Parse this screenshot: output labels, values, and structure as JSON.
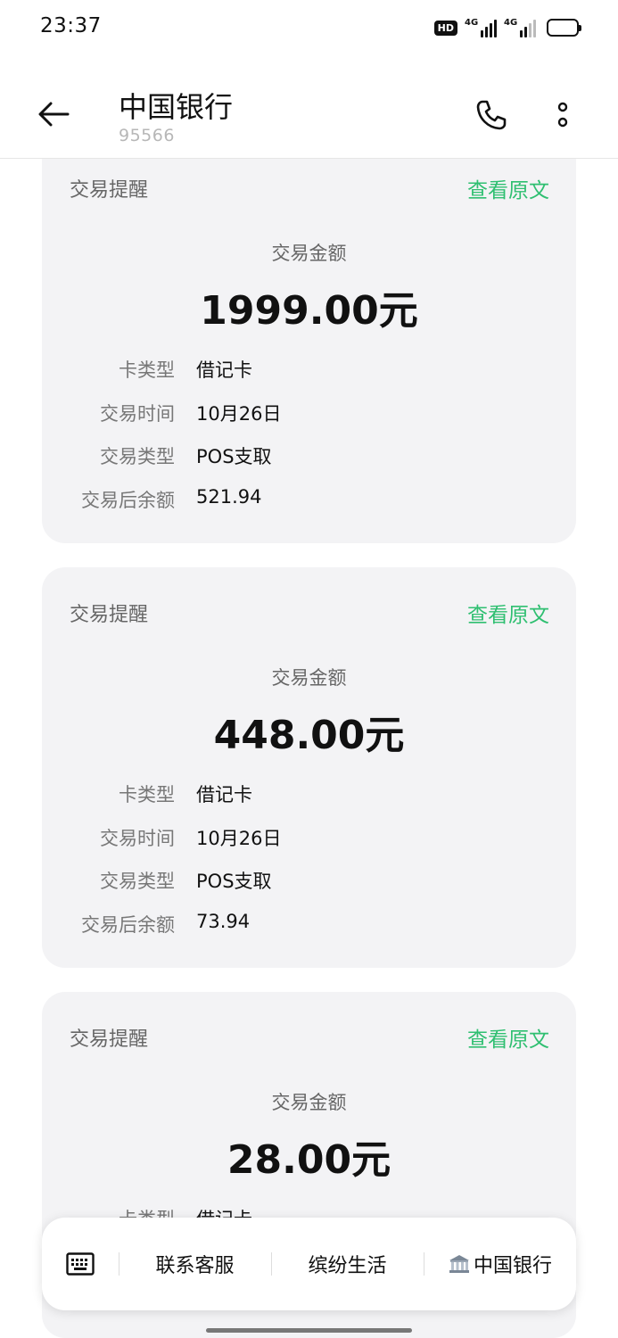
{
  "status_bar": {
    "time": "23:37",
    "hd_label": "HD",
    "network_1": "4G",
    "network_2": "4G"
  },
  "header": {
    "title": "中国银行",
    "subtitle": "95566",
    "back_icon": "arrow-left-icon",
    "call_icon": "phone-icon",
    "more_icon": "more-vertical-icon"
  },
  "messages": [
    {
      "label": "交易提醒",
      "link": "查看原文",
      "amount_caption": "交易金额",
      "amount": "1999.00元",
      "rows": [
        {
          "key": "卡类型",
          "value": "借记卡"
        },
        {
          "key": "交易时间",
          "value": "10月26日"
        },
        {
          "key": "交易类型",
          "value": "POS支取"
        },
        {
          "key": "交易后余额",
          "value": "521.94"
        }
      ]
    },
    {
      "label": "交易提醒",
      "link": "查看原文",
      "amount_caption": "交易金额",
      "amount": "448.00元",
      "rows": [
        {
          "key": "卡类型",
          "value": "借记卡"
        },
        {
          "key": "交易时间",
          "value": "10月26日"
        },
        {
          "key": "交易类型",
          "value": "POS支取"
        },
        {
          "key": "交易后余额",
          "value": "73.94"
        }
      ]
    },
    {
      "label": "交易提醒",
      "link": "查看原文",
      "amount_caption": "交易金额",
      "amount": "28.00元",
      "rows": [
        {
          "key": "卡类型",
          "value": "借记卡"
        }
      ]
    }
  ],
  "bottom_menu": {
    "keyboard_icon": "keyboard-icon",
    "items": [
      "联系客服",
      "缤纷生活",
      "中国银行"
    ],
    "bank_icon": "bank-building-icon"
  },
  "colors": {
    "accent_green": "#2fbf71",
    "card_bg": "#f3f3f5"
  }
}
